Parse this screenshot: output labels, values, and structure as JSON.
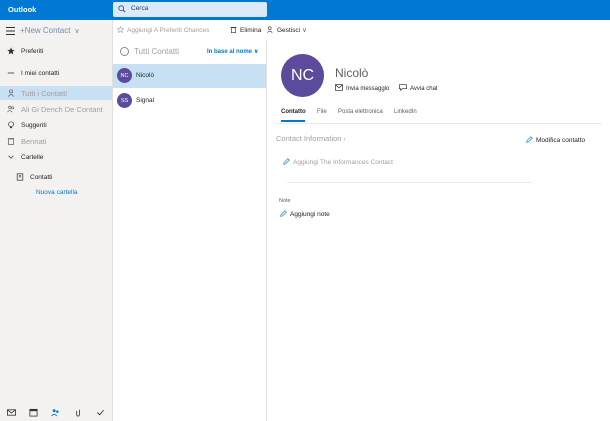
{
  "header": {
    "app_title": "Outlook",
    "search_placeholder": "Cerca"
  },
  "leftnav": {
    "new_contact_label": "New Contact",
    "items": [
      {
        "label": "Preferiti",
        "icon": "star-icon"
      },
      {
        "label": "I miei contatti",
        "icon": "chevron-down-icon"
      },
      {
        "label": "Tutti i Contatti",
        "icon": "person-icon"
      },
      {
        "label": "Ali Gi Dench De Contant",
        "icon": "people-icon"
      },
      {
        "label": "Suggeriti",
        "icon": "lightbulb-icon"
      },
      {
        "label": "Bennati",
        "icon": "trash-icon"
      },
      {
        "label": "Cartelle",
        "icon": "chevron-down-icon"
      },
      {
        "label": "Contatti",
        "icon": "address-book-icon"
      }
    ],
    "new_folder_label": "Nuova cartella",
    "bottom_icons": [
      "mail-icon",
      "calendar-icon",
      "people-icon",
      "attachment-icon",
      "todo-check-icon"
    ]
  },
  "commandbar": {
    "add_favorites_label": "Aggiungi A Preferiti Chances",
    "delete_label": "Elimina",
    "manage_label": "Gestisci"
  },
  "contact_list": {
    "header": "Tutti Contatti",
    "sort_label": "In base al nome",
    "contacts": [
      {
        "initials": "NC",
        "name": "Nicolò"
      },
      {
        "initials": "SS",
        "name": "Signal"
      }
    ]
  },
  "detail": {
    "initials": "NC",
    "name": "Nicolò",
    "send_message_label": "Invia messaggio",
    "start_chat_label": "Avvia chat",
    "tabs": [
      "Contatto",
      "File",
      "Posta elettronica",
      "LinkedIn"
    ],
    "section_title": "Contact Information",
    "edit_contact_label": "Modifica contatto",
    "add_info_label": "Aggiungi The Informances Contact",
    "notes_label": "Note",
    "add_note_label": "Aggiungi note"
  },
  "colors": {
    "brand_blue": "#0078d4",
    "selected_bg": "#c7e0f4",
    "avatar_purple": "#5c4a9c",
    "nav_bg": "#f3f2f1"
  }
}
